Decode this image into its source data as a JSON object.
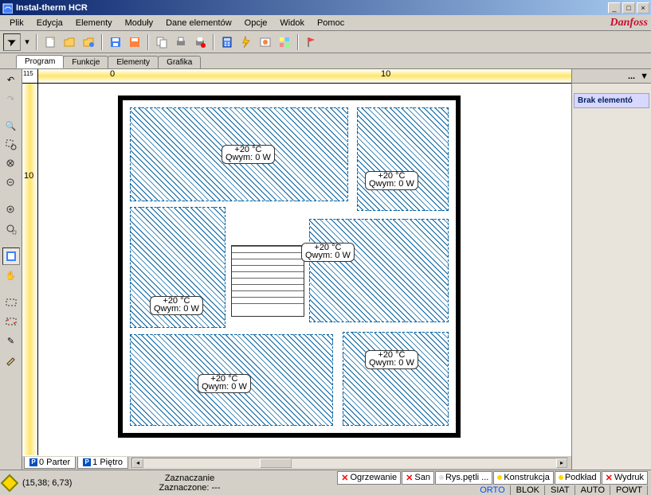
{
  "title": "Instal-therm HCR",
  "menus": [
    "Plik",
    "Edycja",
    "Elementy",
    "Moduły",
    "Dane elementów",
    "Opcje",
    "Widok",
    "Pomoc"
  ],
  "logo": "Danfoss",
  "tabs": {
    "items": [
      "Program",
      "Funkcje",
      "Elementy",
      "Grafika"
    ],
    "active": 0
  },
  "ruler": {
    "corner": "115",
    "h0": "0",
    "h10": "10",
    "v10": "10"
  },
  "rooms": [
    {
      "temp": "+20 °C",
      "qw": "Qwym: 0 W"
    },
    {
      "temp": "+20 °C",
      "qw": "Qwym: 0 W"
    },
    {
      "temp": "+20 °C",
      "qw": "Qwym: 0 W"
    },
    {
      "temp": "+20 °C",
      "qw": "Qwym: 0 W"
    },
    {
      "temp": "+20 °C",
      "qw": "Qwym: 0 W"
    },
    {
      "temp": "+20 °C",
      "qw": "Qwym: 0 W"
    }
  ],
  "rightpanel": {
    "dots": "...",
    "arrow": "▼",
    "link": "Brak elementó"
  },
  "floortabs": [
    {
      "icon": "P",
      "label": "0 Parter"
    },
    {
      "icon": "P",
      "label": "1 Piętro"
    }
  ],
  "status": {
    "coords": "(15,38; 6,73)",
    "mode": "Zaznaczanie",
    "sel": "Zaznaczone: ---"
  },
  "tags": [
    {
      "mark": "x",
      "color": "",
      "label": "Ogrzewanie"
    },
    {
      "mark": "x",
      "color": "",
      "label": "San"
    },
    {
      "mark": "dot",
      "color": "#e0e0e0",
      "label": "Rys.pętli ..."
    },
    {
      "mark": "dot",
      "color": "#ffd700",
      "label": "Konstrukcja"
    },
    {
      "mark": "dot",
      "color": "#ffd700",
      "label": "Podkład"
    },
    {
      "mark": "x",
      "color": "",
      "label": "Wydruk"
    }
  ],
  "flags": [
    "ORTO",
    "BLOK",
    "SIAT",
    "AUTO",
    "POWT"
  ]
}
